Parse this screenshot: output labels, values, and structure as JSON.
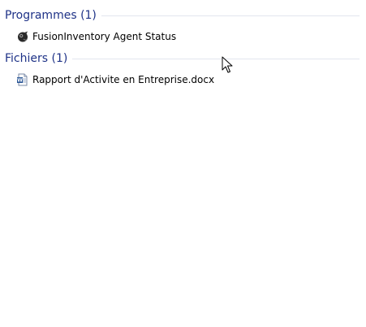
{
  "groups": [
    {
      "title": "Programmes (1)",
      "items": [
        {
          "label": "FusionInventory Agent Status",
          "icon": "fusioninventory-app-icon"
        }
      ]
    },
    {
      "title": "Fichiers (1)",
      "items": [
        {
          "label": "Rapport d'Activite en Entreprise.docx",
          "icon": "word-document-icon"
        }
      ]
    }
  ],
  "colors": {
    "group_title": "#1e3287",
    "separator": "#e3e6ee",
    "word_blue": "#2b5797"
  }
}
